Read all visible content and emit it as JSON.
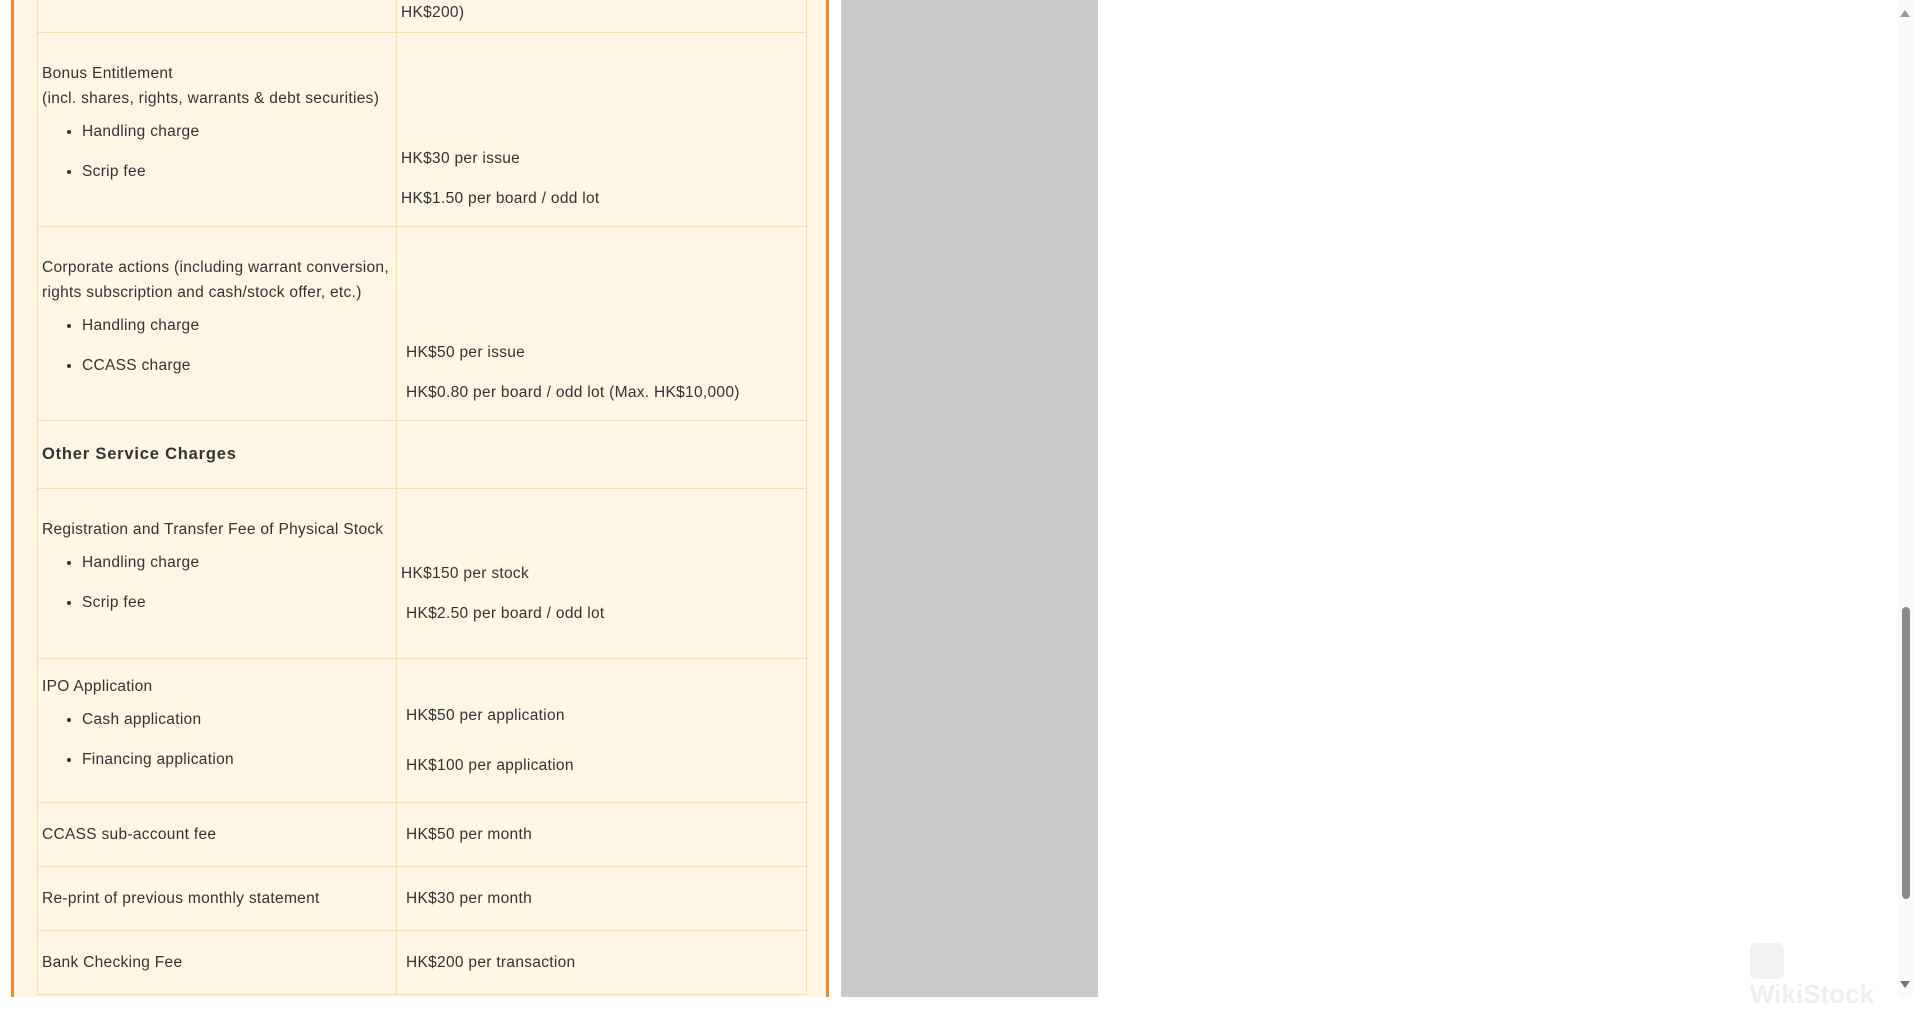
{
  "rows": {
    "prev_value": "HK$200)",
    "bonus": {
      "title": "Bonus Entitlement",
      "subtitle": "(incl. shares, rights, warrants & debt securities)",
      "item1": "Handling charge",
      "item2": "Scrip fee",
      "value1": "HK$30 per issue",
      "value2": "HK$1.50 per board / odd lot"
    },
    "corporate": {
      "title": "Corporate actions (including warrant conversion, rights subscription and cash/stock offer, etc.)",
      "item1": "Handling charge",
      "item2": "CCASS charge",
      "value1": "HK$50 per issue",
      "value2": "HK$0.80 per board / odd lot (Max. HK$10,000)"
    },
    "other_heading": "Other Service Charges",
    "registration": {
      "title": "Registration and Transfer Fee of Physical Stock",
      "item1": "Handling charge",
      "item2": "Scrip fee",
      "value1": "HK$150 per stock",
      "value2": "HK$2.50 per board / odd lot"
    },
    "ipo": {
      "title": "IPO Application",
      "item1": "Cash application",
      "item2": "Financing application",
      "value1": "HK$50 per application",
      "value2": "HK$100 per application"
    },
    "ccass": {
      "label": "CCASS sub-account fee",
      "value": "HK$50 per month"
    },
    "reprint": {
      "label": "Re-print of previous monthly statement",
      "value": "HK$30 per month"
    },
    "bank": {
      "label": "Bank Checking Fee",
      "value": "HK$200 per transaction"
    }
  },
  "watermark": "WikiStock",
  "colors": {
    "accent": "#f08a2c",
    "table_bg": "#fff6e3",
    "border": "#fbe0a2"
  }
}
